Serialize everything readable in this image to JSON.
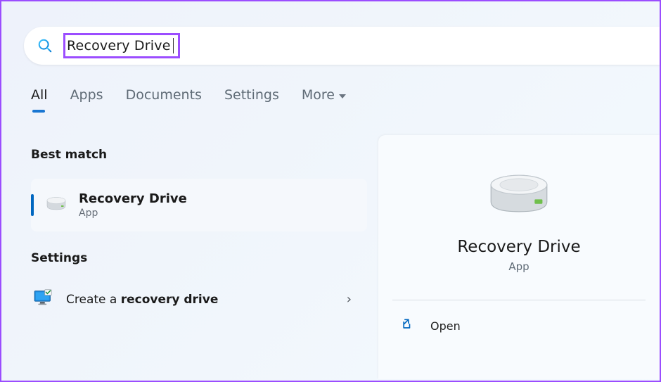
{
  "search": {
    "query": "Recovery Drive"
  },
  "tabs": {
    "items": [
      {
        "label": "All",
        "active": true
      },
      {
        "label": "Apps",
        "active": false
      },
      {
        "label": "Documents",
        "active": false
      },
      {
        "label": "Settings",
        "active": false
      },
      {
        "label": "More",
        "active": false,
        "hasChevron": true
      }
    ]
  },
  "results": {
    "bestMatchLabel": "Best match",
    "bestMatch": {
      "title": "Recovery Drive",
      "subtitle": "App"
    },
    "settingsLabel": "Settings",
    "settingsItems": [
      {
        "prefix": "Create a ",
        "bold": "recovery drive"
      }
    ]
  },
  "preview": {
    "title": "Recovery Drive",
    "subtitle": "App",
    "actions": [
      {
        "label": "Open",
        "icon": "open-external-icon"
      }
    ]
  },
  "icons": {
    "search": "search-icon",
    "drive": "drive-icon",
    "monitor": "monitor-icon",
    "chevronRight": "chevron-right-icon",
    "chevronDown": "chevron-down-icon",
    "openExternal": "open-external-icon"
  },
  "colors": {
    "accent": "#0067c0",
    "highlight": "#9b4dff"
  }
}
